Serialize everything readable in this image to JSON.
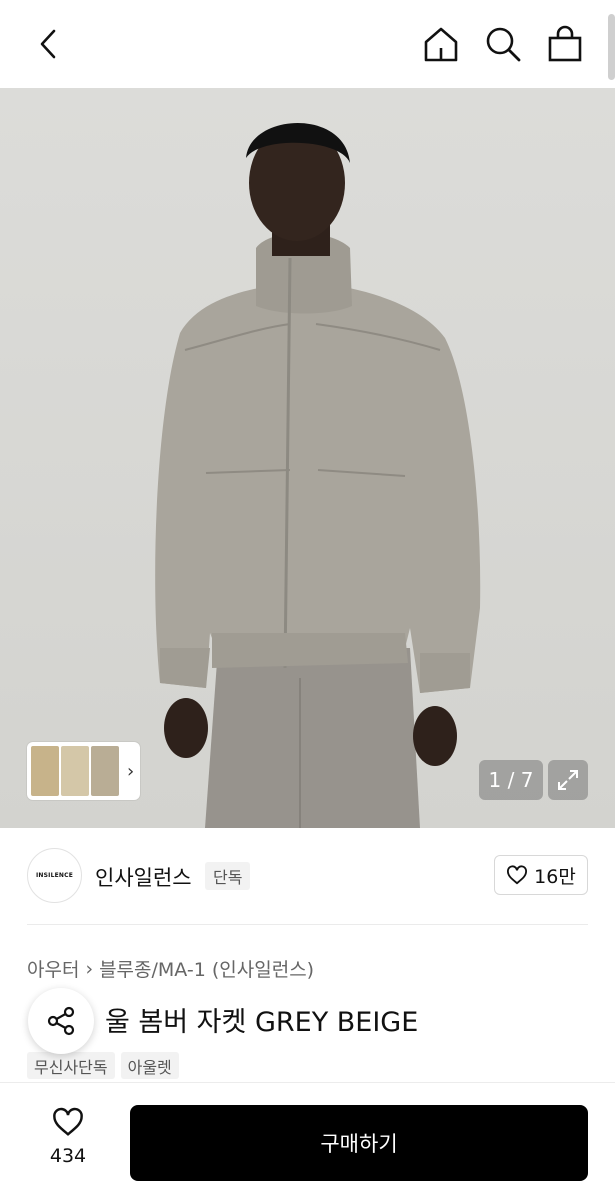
{
  "topbar": {
    "back_icon": "chevron-left-icon",
    "home_icon": "home-icon",
    "search_icon": "search-icon",
    "cart_icon": "shopping-bag-icon"
  },
  "gallery": {
    "counter": "1 / 7",
    "current_index": 1,
    "total_images": 7,
    "expand_icon": "expand-icon"
  },
  "brand": {
    "logo_text": "INSILENCE",
    "name": "인사일런스",
    "tag": "단독",
    "like_count": "16만"
  },
  "product": {
    "breadcrumb": [
      "아우터",
      "블루종/MA-1 (인사일런스)"
    ],
    "title": "울 봄버 자켓 GREY BEIGE",
    "tags": [
      "무신사단독",
      "아울렛"
    ]
  },
  "bottombar": {
    "wish_count": "434",
    "buy_label": "구매하기"
  },
  "colors": {
    "primary_button": "#000000",
    "tag_bg": "#f2f2f2",
    "jacket": "#a9a59c",
    "background": "#d6d6d3"
  }
}
